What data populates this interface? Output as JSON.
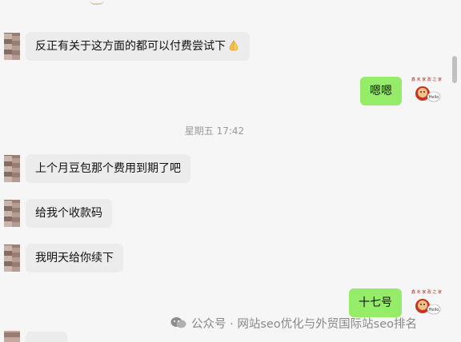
{
  "messages": [
    {
      "side": "left",
      "text": "反正有关于这方面的都可以付费尝试下",
      "emoji": "folded-hands"
    },
    {
      "side": "right",
      "text": "嗯嗯"
    },
    {
      "side": "left",
      "text": "上个月豆包那个费用到期了吧"
    },
    {
      "side": "left",
      "text": "给我个收款码"
    },
    {
      "side": "left",
      "text": "我明天给你续下"
    },
    {
      "side": "right",
      "text": "十七号"
    }
  ],
  "timestamp": "星期五 17:42",
  "watermark": {
    "text": "公众号 · 网站seo优化与外贸国际站seo排名",
    "icon": "wechat-official-account-icon"
  },
  "colors": {
    "background": "#f6f6f7",
    "bubble_left": "#ececec",
    "bubble_right": "#95ec69",
    "timestamp": "#9a9a9a"
  }
}
